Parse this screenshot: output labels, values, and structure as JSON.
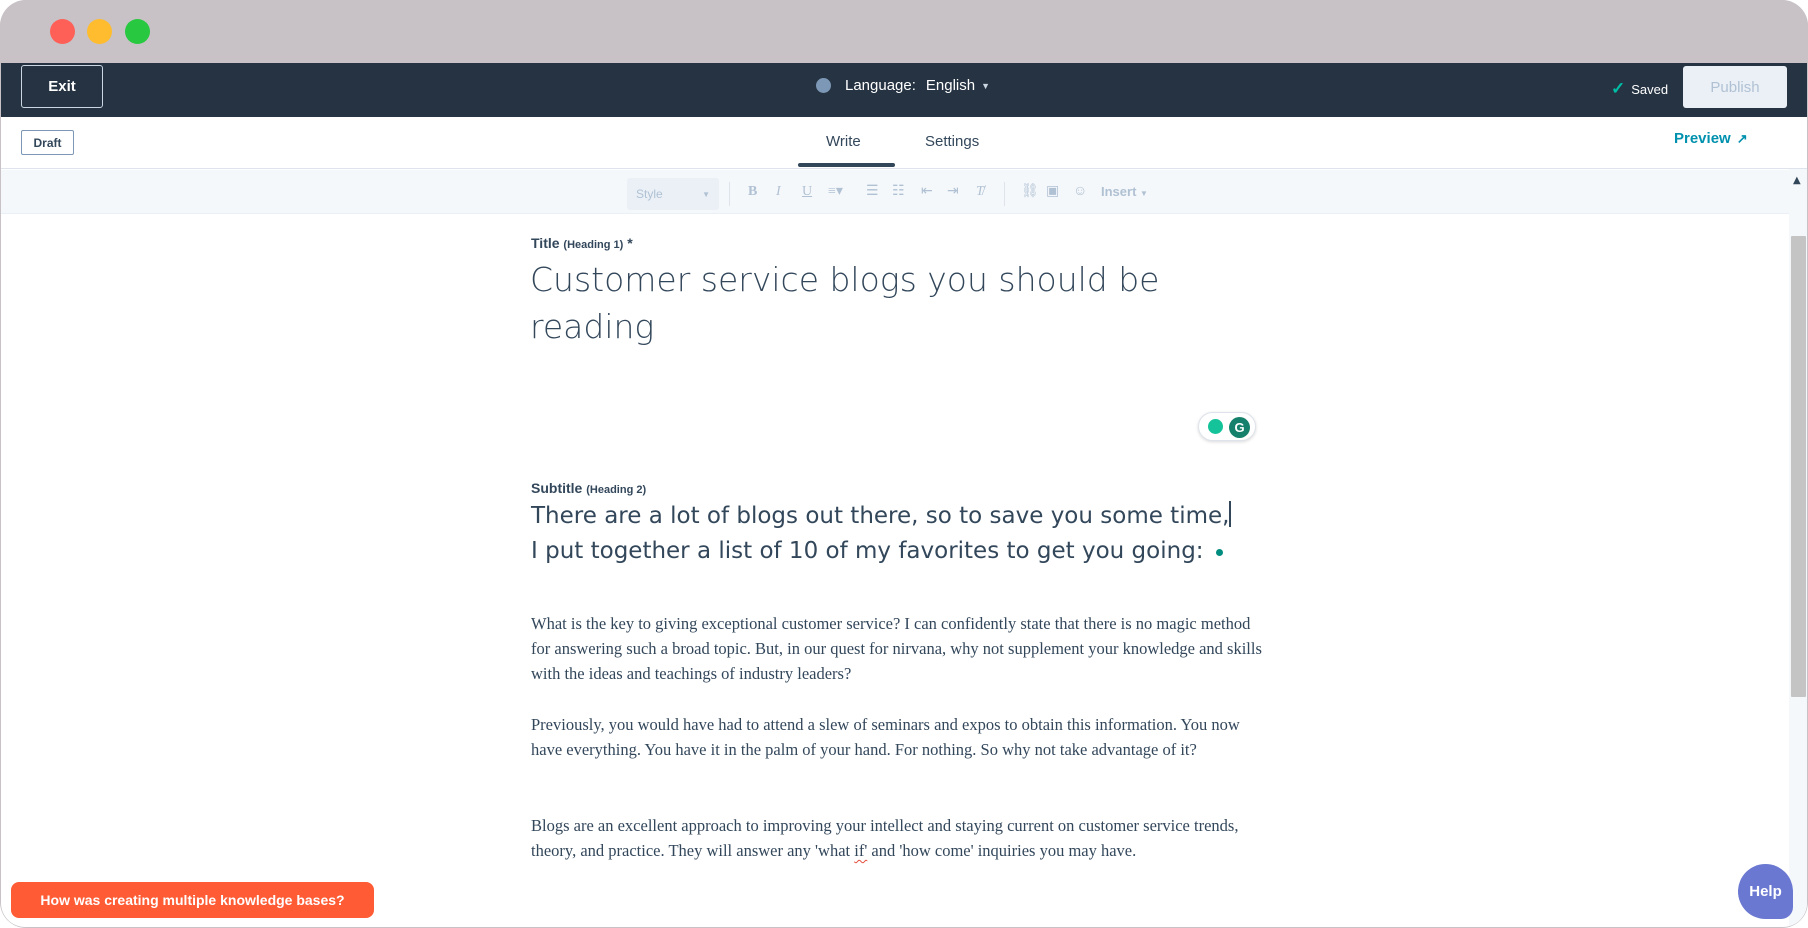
{
  "top_bar": {
    "exit_label": "Exit",
    "language_label": "Language:",
    "language_value": "English",
    "saved_label": "Saved",
    "publish_label": "Publish"
  },
  "sub_header": {
    "status_badge": "Draft",
    "tabs": [
      {
        "label": "Write",
        "active": true
      },
      {
        "label": "Settings",
        "active": false
      }
    ],
    "preview_label": "Preview"
  },
  "toolbar": {
    "style_placeholder": "Style",
    "insert_label": "Insert",
    "icons": [
      "bold-icon",
      "italic-icon",
      "underline-icon",
      "align-icon",
      "bulleted-list-icon",
      "numbered-list-icon",
      "indent-decrease-icon",
      "indent-increase-icon",
      "clear-format-icon",
      "link-icon",
      "image-icon",
      "emoji-icon"
    ]
  },
  "editor": {
    "title_label": "Title",
    "title_hint": "(Heading 1)",
    "title_required": "*",
    "title_text": "Customer service blogs you should be reading",
    "subtitle_label": "Subtitle",
    "subtitle_hint": "(Heading 2)",
    "subtitle_line1": "There are a lot of blogs out there, so to save you some time,",
    "subtitle_line2": "I put together a list of 10 of my favorites to get you going:",
    "paragraphs": [
      "What is the key to giving exceptional customer service? I can confidently state that there is no magic method for answering such a broad topic. But, in our quest for nirvana, why not supplement your knowledge and skills with the ideas and teachings of industry leaders?",
      "Previously, you would have had to attend a slew of seminars and expos to obtain this information. You now have everything. You have it in the palm of your hand. For nothing. So why not take advantage of it?"
    ],
    "paragraph3_before": "Blogs are an excellent approach to improving your intellect and staying current on customer service trends, theory, and practice. They will answer any 'what ",
    "paragraph3_flagged": "if'",
    "paragraph3_after": " and 'how come' inquiries you may have."
  },
  "feedback_banner": "How was creating multiple knowledge bases?",
  "help_label": "Help",
  "colors": {
    "topbar": "#253342",
    "accent_teal": "#0091ae",
    "feedback_orange": "#ff5c35",
    "help_purple": "#6a78d1"
  }
}
